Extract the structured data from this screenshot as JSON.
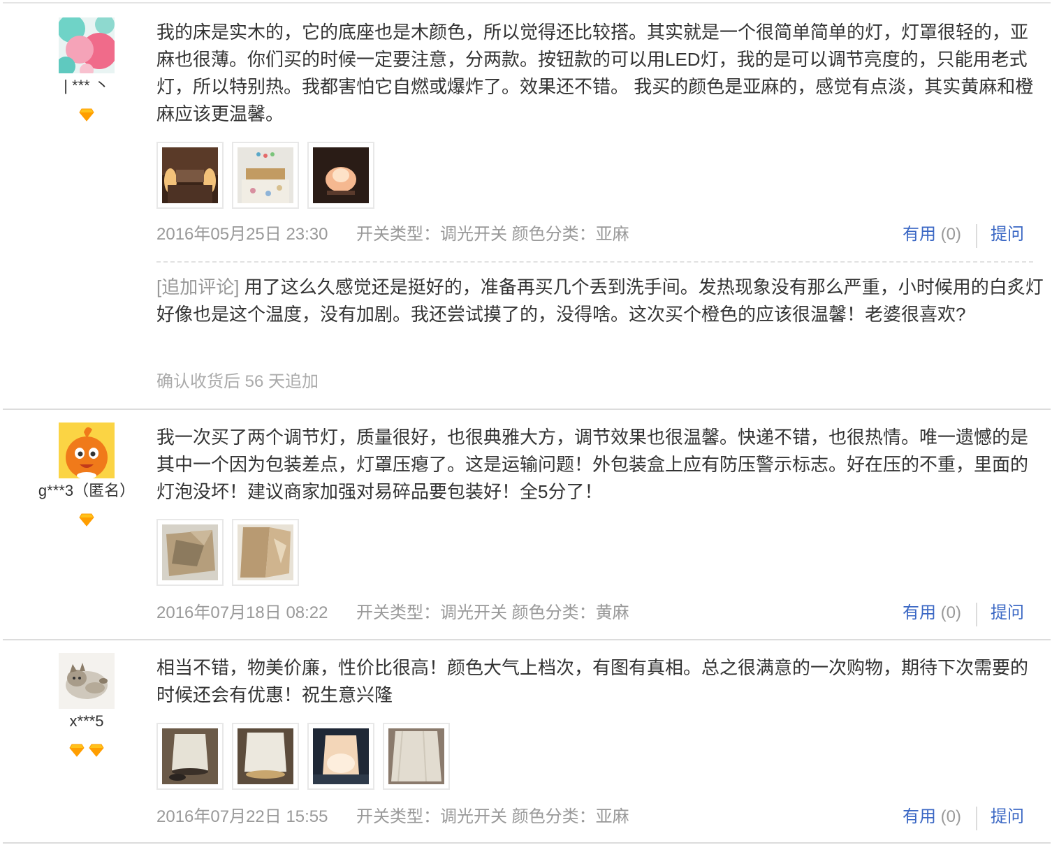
{
  "reviews": [
    {
      "nick": "| *** 丶",
      "vip_level": 1,
      "avatar": "circles-avatar",
      "text": "我的床是实木的，它的底座也是木颜色，所以觉得还比较搭。其实就是一个很简单简单的灯，灯罩很轻的，亚麻也很薄。你们买的时候一定要注意，分两款。按钮款的可以用LED灯，我的是可以调节亮度的，只能用老式灯，所以特别热。我都害怕它自燃或爆炸了。效果还不错。 我买的颜色是亚麻的，感觉有点淡，其实黄麻和橙麻应该更温馨。",
      "photos": [
        "bedroom-night-photo",
        "bedroom-day-photo",
        "lamp-lit-photo"
      ],
      "date": "2016年05月25日 23:30",
      "attrs": "开关类型：调光开关   颜色分类：亚麻",
      "useful_label": "有用",
      "useful_count": "(0)",
      "ask_label": "提问",
      "append": {
        "tag": "[追加评论]",
        "text": "用了这么久感觉还是挺好的，准备再买几个丢到洗手间。发热现象没有那么严重，小时候用的白炙灯好像也是这个温度，没有加剧。我还尝试摸了的，没得啥。这次买个橙色的应该很温馨！老婆很喜欢?",
        "time": "确认收货后 56 天追加"
      }
    },
    {
      "nick": "g***3（匿名）",
      "vip_level": 1,
      "avatar": "orange-mascot-avatar",
      "text": "我一次买了两个调节灯，质量很好，也很典雅大方，调节效果也很温馨。快递不错，也很热情。唯一遗憾的是其中一个因为包装差点，灯罩压瘪了。这是运输问题！外包装盒上应有防压警示标志。好在压的不重，里面的灯泡没坏！建议商家加强对易碎品要包装好！全5分了！",
      "photos": [
        "crushed-shade-photo",
        "shade-side-photo"
      ],
      "date": "2016年07月18日 08:22",
      "attrs": "开关类型：调光开关   颜色分类：黄麻",
      "useful_label": "有用",
      "useful_count": "(0)",
      "ask_label": "提问"
    },
    {
      "nick": "x***5",
      "vip_level": 2,
      "avatar": "kitten-avatar",
      "text": "相当不错，物美价廉，性价比很高！颜色大气上档次，有图有真相。总之很满意的一次购物，期待下次需要的时候还会有优惠！祝生意兴隆",
      "photos": [
        "lamp-shade-photo-1",
        "lamp-shade-photo-2",
        "lamp-glow-photo",
        "lamp-closeup-photo"
      ],
      "date": "2016年07月22日 15:55",
      "attrs": "开关类型：调光开关   颜色分类：亚麻",
      "useful_label": "有用",
      "useful_count": "(0)",
      "ask_label": "提问"
    }
  ]
}
